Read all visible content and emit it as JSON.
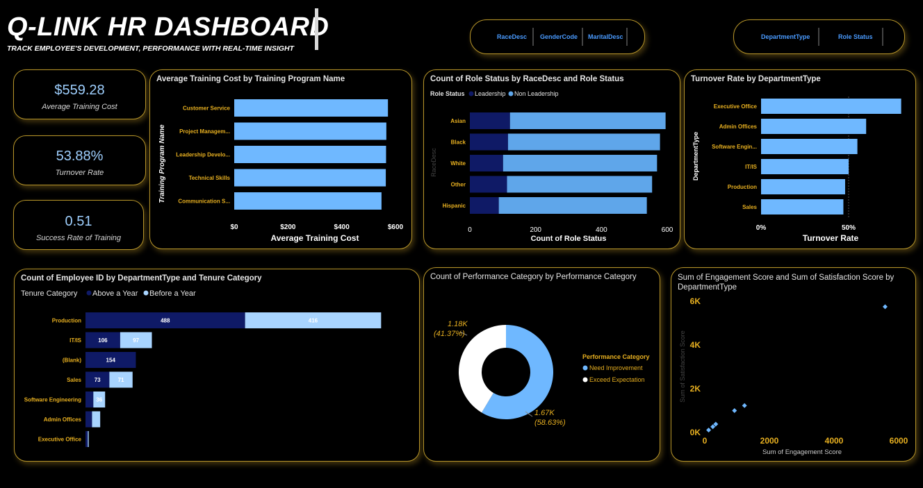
{
  "header": {
    "title": "Q-LINK HR DASHBOARD",
    "subtitle": "TRACK EMPLOYEE'S DEVELOPMENT, PERFORMANCE WITH REAL-TIME INSIGHT"
  },
  "slicers_left": [
    "RaceDesc",
    "GenderCode",
    "MaritalDesc"
  ],
  "slicers_right": [
    "DepartmentType",
    "Role Status"
  ],
  "kpis": [
    {
      "value": "$559.28",
      "label": "Average Training Cost"
    },
    {
      "value": "53.88%",
      "label": "Turnover Rate"
    },
    {
      "value": "0.51",
      "label": "Success Rate of Training"
    }
  ],
  "colors": {
    "accent_gold": "#e8b020",
    "panel_border": "#b8962a",
    "bar_light": "#6fb8ff",
    "bar_mid": "#5fa6ea",
    "bar_dark": "#0f1a66",
    "bar_pale": "#a8d4ff",
    "kpi_text": "#9fd0ff"
  },
  "chart_data": [
    {
      "type": "bar",
      "title": "Average Training Cost by Training Program Name",
      "ylabel": "Training Program Name",
      "xlabel": "Average Training Cost",
      "categories": [
        "Customer Service",
        "Project Managem...",
        "Leadership Develo...",
        "Technical Skills",
        "Communication S..."
      ],
      "values": [
        572,
        566,
        565,
        564,
        548
      ],
      "xlim": [
        0,
        600
      ],
      "xticks": [
        "$0",
        "$200",
        "$400",
        "$600"
      ]
    },
    {
      "type": "bar",
      "title": "Count of Role Status by RaceDesc and Role Status",
      "legend_title": "Role Status",
      "ylabel": "RaceDesc",
      "xlabel": "Count of Role Status",
      "categories": [
        "Asian",
        "Black",
        "White",
        "Other",
        "Hispanic"
      ],
      "series": [
        {
          "name": "Leadership",
          "values": [
            122,
            116,
            101,
            113,
            88
          ]
        },
        {
          "name": "Non Leadership",
          "values": [
            473,
            462,
            468,
            441,
            450
          ]
        }
      ],
      "xlim": [
        0,
        600
      ],
      "xticks": [
        "0",
        "200",
        "400",
        "600"
      ]
    },
    {
      "type": "bar",
      "title": "Turnover Rate by DepartmentType",
      "ylabel": "DepartmentType",
      "xlabel": "Turnover Rate",
      "categories": [
        "Executive Office",
        "Admin Offices",
        "Software Engin...",
        "IT/IS",
        "Production",
        "Sales"
      ],
      "values": [
        0.8,
        0.6,
        0.55,
        0.5,
        0.48,
        0.47
      ],
      "xticks": [
        "0%",
        "50%"
      ]
    },
    {
      "type": "bar",
      "title": "Count of Employee ID by DepartmentType and Tenure Category",
      "legend_title": "Tenure Category",
      "categories": [
        "Production",
        "IT/IS",
        "(Blank)",
        "Sales",
        "Software Engineering",
        "Admin Offices",
        "Executive Office"
      ],
      "series": [
        {
          "name": "Above a Year",
          "values": [
            488,
            106,
            154,
            73,
            24,
            20,
            7
          ]
        },
        {
          "name": "Before a Year",
          "values": [
            416,
            97,
            0,
            71,
            36,
            25,
            3
          ]
        }
      ],
      "data_labels": [
        [
          "488",
          "416"
        ],
        [
          "106",
          "97"
        ],
        [
          "154",
          ""
        ],
        [
          "73",
          "71"
        ],
        [
          "",
          "36"
        ],
        [
          "",
          ""
        ],
        [
          "",
          ""
        ]
      ]
    },
    {
      "type": "pie",
      "title": "Count of Performance Category by Performance Category",
      "legend_title": "Performance Category",
      "labels": [
        "Need Improvement",
        "Exceed Expectation"
      ],
      "values": [
        1670,
        1180
      ],
      "data_labels": [
        [
          "1.67K",
          "(58.63%)"
        ],
        [
          "1.18K",
          "(41.37%)"
        ]
      ]
    },
    {
      "type": "scatter",
      "title": "Sum of Engagement Score and Sum of Satisfaction Score by DepartmentType",
      "xlabel": "Sum of Engagement Score",
      "ylabel": "Sum of Satisfaction Score",
      "x": [
        5580,
        1230,
        920,
        340,
        250,
        120
      ],
      "y": [
        5750,
        1230,
        1000,
        380,
        260,
        110
      ],
      "xlim": [
        0,
        6000
      ],
      "ylim": [
        0,
        6000
      ],
      "xticks": [
        "0",
        "2000",
        "4000",
        "6000"
      ],
      "yticks": [
        "0K",
        "2K",
        "4K",
        "6K"
      ]
    }
  ]
}
